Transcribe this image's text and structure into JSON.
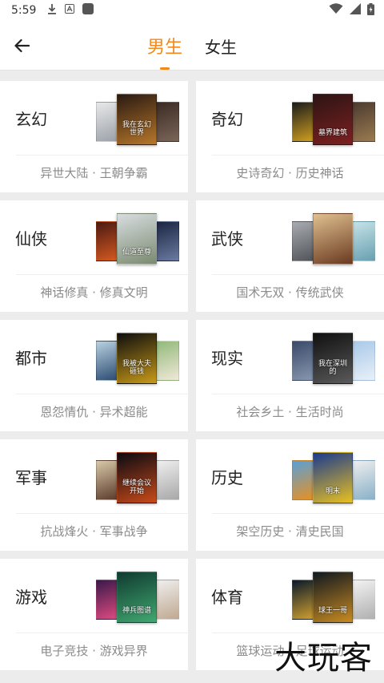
{
  "status": {
    "time": "5:59"
  },
  "header": {
    "tabs": [
      {
        "label": "男生",
        "active": true
      },
      {
        "label": "女生",
        "active": false
      }
    ]
  },
  "categories": [
    {
      "name": "玄幻",
      "sub": "异世大陆 · 王朝争霸",
      "covers": [
        {
          "colors": [
            "#e8e8e8",
            "#9aa0a8"
          ]
        },
        {
          "colors": [
            "#2a1a12",
            "#b7772a"
          ],
          "title": "我在玄幻世界"
        },
        {
          "colors": [
            "#3a2a24",
            "#7a6558"
          ]
        }
      ]
    },
    {
      "name": "奇幻",
      "sub": "史诗奇幻 · 历史神话",
      "covers": [
        {
          "colors": [
            "#1c1c1c",
            "#d0a020"
          ]
        },
        {
          "colors": [
            "#2c1414",
            "#7d2020"
          ],
          "title": "墓界建筑"
        },
        {
          "colors": [
            "#4a3a30",
            "#9a7a50"
          ]
        }
      ]
    },
    {
      "name": "仙侠",
      "sub": "神话修真 · 修真文明",
      "covers": [
        {
          "colors": [
            "#4a1a12",
            "#d85a20"
          ]
        },
        {
          "colors": [
            "#d8dde0",
            "#7a8a70"
          ],
          "title": "仙道至尊"
        },
        {
          "colors": [
            "#1a2440",
            "#6a7aa0"
          ]
        }
      ]
    },
    {
      "name": "武侠",
      "sub": "国术无双 · 传统武侠",
      "covers": [
        {
          "colors": [
            "#a8acb0",
            "#505458"
          ]
        },
        {
          "colors": [
            "#e0c090",
            "#6a3a20"
          ]
        },
        {
          "colors": [
            "#c8e4e8",
            "#68a0b0"
          ]
        }
      ]
    },
    {
      "name": "都市",
      "sub": "恩怨情仇 · 异术超能",
      "covers": [
        {
          "colors": [
            "#b8d0e0",
            "#2a4a70"
          ]
        },
        {
          "colors": [
            "#0e0e0e",
            "#c89a18"
          ],
          "title": "我被大夫砸钱"
        },
        {
          "colors": [
            "#90b878",
            "#f0e8d8"
          ]
        }
      ]
    },
    {
      "name": "现实",
      "sub": "社会乡土 · 生活时尚",
      "covers": [
        {
          "colors": [
            "#3a4a6a",
            "#8898b0"
          ]
        },
        {
          "colors": [
            "#101010",
            "#5a5a5a"
          ],
          "title": "我在深圳的"
        },
        {
          "colors": [
            "#a8c8e8",
            "#e8f0f8"
          ]
        }
      ]
    },
    {
      "name": "军事",
      "sub": "抗战烽火 · 军事战争",
      "covers": [
        {
          "colors": [
            "#d8c8a8",
            "#5a3a2a"
          ]
        },
        {
          "colors": [
            "#0a0a14",
            "#c84a18"
          ],
          "title": "继续会议开始"
        },
        {
          "colors": [
            "#f0f0f0",
            "#a8a8a8"
          ]
        }
      ]
    },
    {
      "name": "历史",
      "sub": "架空历史 · 清史民国",
      "covers": [
        {
          "colors": [
            "#5aa0d8",
            "#e89020"
          ]
        },
        {
          "colors": [
            "#1a3a90",
            "#e8c020"
          ],
          "title": "明末"
        },
        {
          "colors": [
            "#f0f0f0",
            "#8ab0c8"
          ]
        }
      ]
    },
    {
      "name": "游戏",
      "sub": "电子竞技 · 游戏异界",
      "covers": [
        {
          "colors": [
            "#3a1a4a",
            "#e04a80"
          ]
        },
        {
          "colors": [
            "#103a30",
            "#40a870"
          ],
          "title": "神兵图谱"
        },
        {
          "colors": [
            "#f0f0f0",
            "#c0a890"
          ]
        }
      ]
    },
    {
      "name": "体育",
      "sub": "篮球运动 · 足球运动",
      "covers": [
        {
          "colors": [
            "#0a1a2a",
            "#d0a030"
          ]
        },
        {
          "colors": [
            "#101820",
            "#c88a20"
          ],
          "title": "球王一哥"
        },
        {
          "colors": [
            "#f4f4f4",
            "#b0b0b0"
          ]
        }
      ]
    }
  ],
  "watermark": "大玩客"
}
